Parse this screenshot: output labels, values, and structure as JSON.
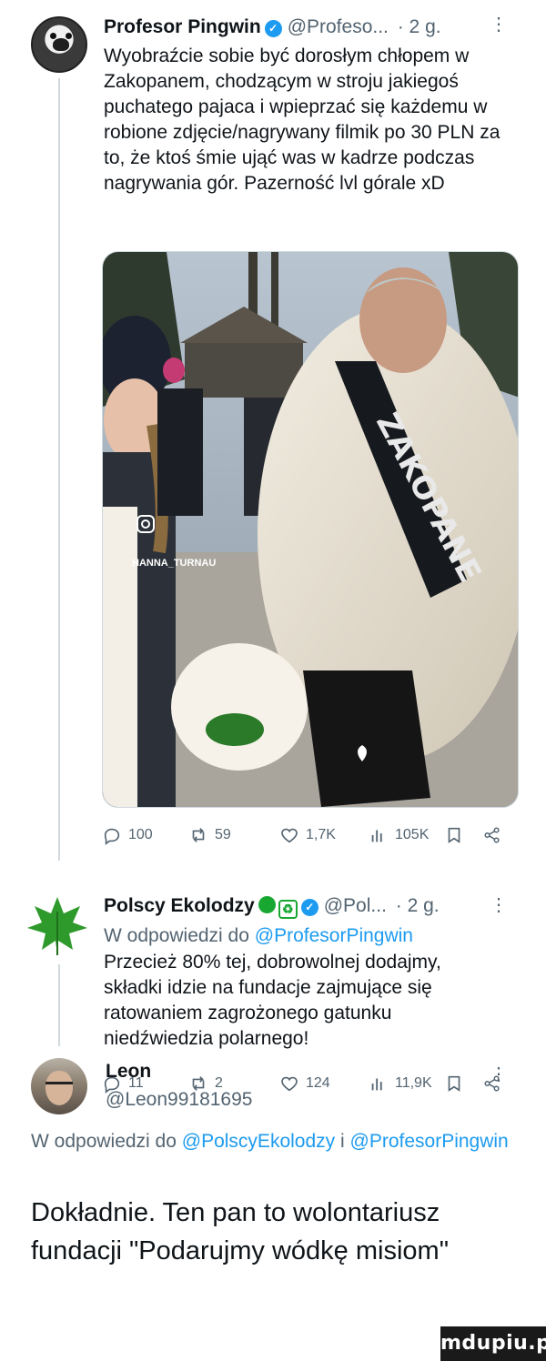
{
  "tweets": [
    {
      "author": "Profesor Pingwin",
      "handle": "@Profeso...",
      "time": "· 2 g.",
      "text": "Wyobraźcie sobie być dorosłym chłopem w Zakopanem, chodzącym w stroju jakiegoś puchatego pajaca i wpieprzać się każdemu w robione zdjęcie/nagrywany filmik po 30 PLN za to, że ktoś śmie ująć was w kadrze podczas nagrywania gór. Pazerność lvl górale xD",
      "media_overlay": {
        "watermark": "HANNA_TURNAU",
        "sash_text": "ZAKOPANE"
      },
      "stats": {
        "replies": "100",
        "reposts": "59",
        "likes": "1,7K",
        "views": "105K"
      }
    },
    {
      "author": "Polscy Ekolodzy",
      "handle": "@Pol...",
      "time": "· 2 g.",
      "reply_prefix": "W odpowiedzi do",
      "reply_mention": "@ProfesorPingwin",
      "text": "Przecież 80% tej, dobrowolnej dodajmy, składki idzie na fundacje zajmujące się ratowaniem zagrożonego gatunku niedźwiedzia polarnego!",
      "stats": {
        "replies": "11",
        "reposts": "2",
        "likes": "124",
        "views": "11,9K"
      }
    },
    {
      "author": "Leon",
      "handle": "@Leon99181695",
      "reply_prefix": "W odpowiedzi do",
      "reply_mention_1": "@PolscyEkolodzy",
      "reply_join": "i",
      "reply_mention_2": "@ProfesorPingwin",
      "text": "Dokładnie. Ten pan to wolontariusz fundacji \"Podarujmy wódkę misiom\""
    }
  ],
  "watermark": "mdupiu.pl",
  "colors": {
    "accent": "#1d9bf0",
    "muted": "#536471",
    "text": "#0f1419",
    "eco_green": "#18a832"
  }
}
